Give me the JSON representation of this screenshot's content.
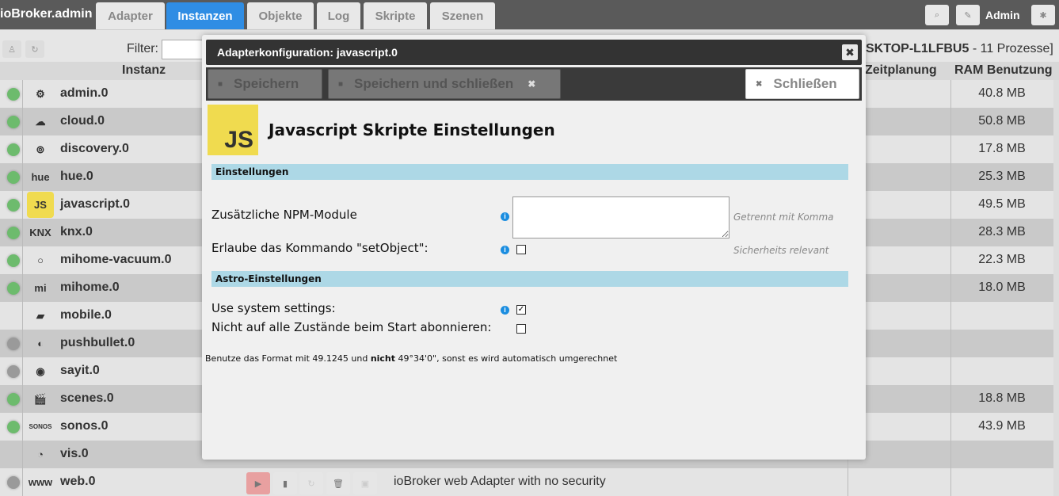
{
  "header": {
    "brand": "ioBroker.admin",
    "tabs": [
      "Adapter",
      "Instanzen",
      "Objekte",
      "Log",
      "Skripte",
      "Szenen"
    ],
    "active_tab": "Instanzen",
    "user": "Admin"
  },
  "toolbar": {
    "filter_label": "Filter:",
    "filter_value": "",
    "host": "SKTOP-L1LFBU5",
    "processes": " - 11 Prozesse]"
  },
  "columns": {
    "instance": "Instanz",
    "schedule": "Zeitplanung",
    "ram": "RAM Benutzung"
  },
  "instances": [
    {
      "name": "admin.0",
      "ram": "40.8 MB",
      "status": "green",
      "icon": "⚙"
    },
    {
      "name": "cloud.0",
      "ram": "50.8 MB",
      "status": "green",
      "icon": "☁"
    },
    {
      "name": "discovery.0",
      "ram": "17.8 MB",
      "status": "green",
      "icon": "⊚"
    },
    {
      "name": "hue.0",
      "ram": "25.3 MB",
      "status": "green",
      "icon": "hue"
    },
    {
      "name": "javascript.0",
      "ram": "49.5 MB",
      "status": "green",
      "icon": "JS"
    },
    {
      "name": "knx.0",
      "ram": "28.3 MB",
      "status": "green",
      "icon": "KNX"
    },
    {
      "name": "mihome-vacuum.0",
      "ram": "22.3 MB",
      "status": "green",
      "icon": "○"
    },
    {
      "name": "mihome.0",
      "ram": "18.0 MB",
      "status": "green",
      "icon": "mi"
    },
    {
      "name": "mobile.0",
      "ram": "",
      "status": "none",
      "icon": "▰"
    },
    {
      "name": "pushbullet.0",
      "ram": "",
      "status": "gray",
      "icon": "◐"
    },
    {
      "name": "sayit.0",
      "ram": "",
      "status": "gray",
      "icon": "◉"
    },
    {
      "name": "scenes.0",
      "ram": "18.8 MB",
      "status": "green",
      "icon": "🎬"
    },
    {
      "name": "sonos.0",
      "ram": "43.9 MB",
      "status": "green",
      "icon": "SONOS"
    },
    {
      "name": "vis.0",
      "ram": "",
      "status": "none",
      "icon": "◔"
    },
    {
      "name": "web.0",
      "ram": "",
      "status": "gray",
      "icon": "www",
      "description": "ioBroker web Adapter with no security"
    }
  ],
  "dialog": {
    "title": "Adapterkonfiguration: javascript.0",
    "save": "Speichern",
    "save_close": "Speichern und schließen",
    "close": "Schließen",
    "logo": "JS",
    "heading": "Javascript Skripte Einstellungen",
    "section1": "Einstellungen",
    "npm_label": "Zusätzliche NPM-Module",
    "npm_value": "",
    "npm_hint": "Getrennt mit Komma",
    "setobject_label": "Erlaube das Kommando \"setObject\":",
    "setobject_hint": "Sicherheits relevant",
    "setobject_checked": false,
    "section2": "Astro-Einstellungen",
    "system_label": "Use system settings:",
    "system_checked": true,
    "subscribe_label": "Nicht auf alle Zustände beim Start abonnieren:",
    "subscribe_checked": false,
    "note_pre": "Benutze das Format mit 49.1245 und ",
    "note_bold": "nicht",
    "note_post": " 49°34'0\", sonst es wird automatisch umgerechnet"
  },
  "colors": {
    "accent": "#2f8de4",
    "section": "#add8e6",
    "green": "#6dbb6d",
    "gray": "#9a9a9a"
  }
}
